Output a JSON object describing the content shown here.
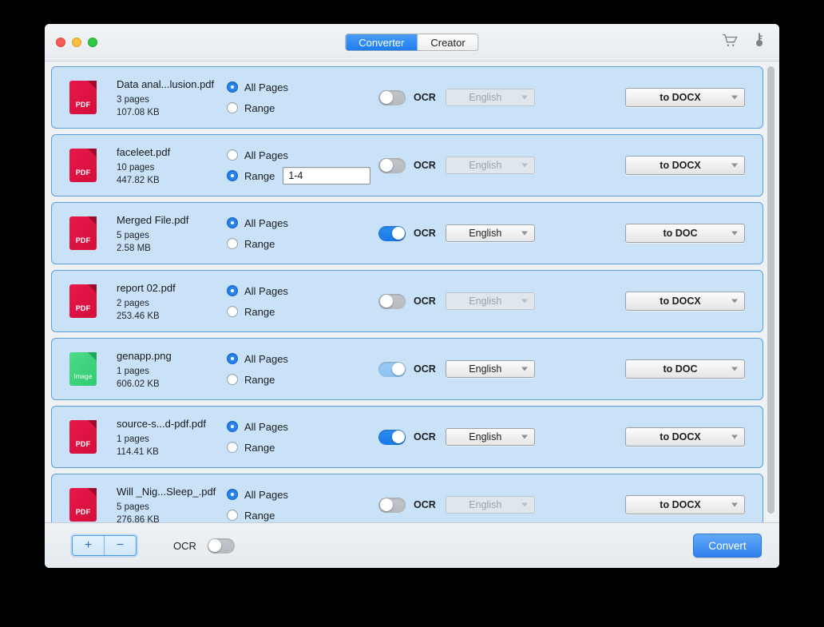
{
  "window": {
    "traffic_lights": [
      "close",
      "minimize",
      "zoom"
    ],
    "tabs": [
      {
        "label": "Converter",
        "active": true
      },
      {
        "label": "Creator",
        "active": false
      }
    ],
    "toolbar_icons": [
      {
        "name": "cart-icon"
      },
      {
        "name": "key-icon"
      }
    ]
  },
  "labels": {
    "all_pages": "All Pages",
    "range": "Range",
    "ocr": "OCR"
  },
  "files": [
    {
      "icon": "pdf",
      "icon_tag": "PDF",
      "name": "Data anal...lusion.pdf",
      "pages": "3 pages",
      "size": "107.08 KB",
      "selection": "all",
      "range_value": "",
      "ocr_on": false,
      "ocr_dim": false,
      "language": "English",
      "language_enabled": false,
      "format": "to DOCX"
    },
    {
      "icon": "pdf",
      "icon_tag": "PDF",
      "name": "faceleet.pdf",
      "pages": "10 pages",
      "size": "447.82 KB",
      "selection": "range",
      "range_value": "1-4",
      "ocr_on": false,
      "ocr_dim": false,
      "language": "English",
      "language_enabled": false,
      "format": "to DOCX"
    },
    {
      "icon": "pdf",
      "icon_tag": "PDF",
      "name": "Merged File.pdf",
      "pages": "5 pages",
      "size": "2.58 MB",
      "selection": "all",
      "range_value": "",
      "ocr_on": true,
      "ocr_dim": false,
      "language": "English",
      "language_enabled": true,
      "format": "to DOC"
    },
    {
      "icon": "pdf",
      "icon_tag": "PDF",
      "name": "report 02.pdf",
      "pages": "2 pages",
      "size": "253.46 KB",
      "selection": "all",
      "range_value": "",
      "ocr_on": false,
      "ocr_dim": false,
      "language": "English",
      "language_enabled": false,
      "format": "to DOCX"
    },
    {
      "icon": "image",
      "icon_tag": "Image",
      "name": "genapp.png",
      "pages": "1 pages",
      "size": "606.02 KB",
      "selection": "all",
      "range_value": "",
      "ocr_on": true,
      "ocr_dim": true,
      "language": "English",
      "language_enabled": true,
      "format": "to DOC"
    },
    {
      "icon": "pdf",
      "icon_tag": "PDF",
      "name": "source-s...d-pdf.pdf",
      "pages": "1 pages",
      "size": "114.41 KB",
      "selection": "all",
      "range_value": "",
      "ocr_on": true,
      "ocr_dim": false,
      "language": "English",
      "language_enabled": true,
      "format": "to DOCX"
    },
    {
      "icon": "pdf",
      "icon_tag": "PDF",
      "name": "Will _Nig...Sleep_.pdf",
      "pages": "5 pages",
      "size": "276.86 KB",
      "selection": "all",
      "range_value": "",
      "ocr_on": false,
      "ocr_dim": false,
      "language": "English",
      "language_enabled": false,
      "format": "to DOCX"
    }
  ],
  "bottom": {
    "add_label": "+",
    "remove_label": "−",
    "ocr_label": "OCR",
    "ocr_on": false,
    "convert_label": "Convert"
  },
  "colors": {
    "accent": "#1d7df2",
    "row_bg": "#c9e2f8",
    "row_border": "#5c9fe0",
    "pdf_icon": "#d30f3c",
    "image_icon": "#30cb72"
  }
}
